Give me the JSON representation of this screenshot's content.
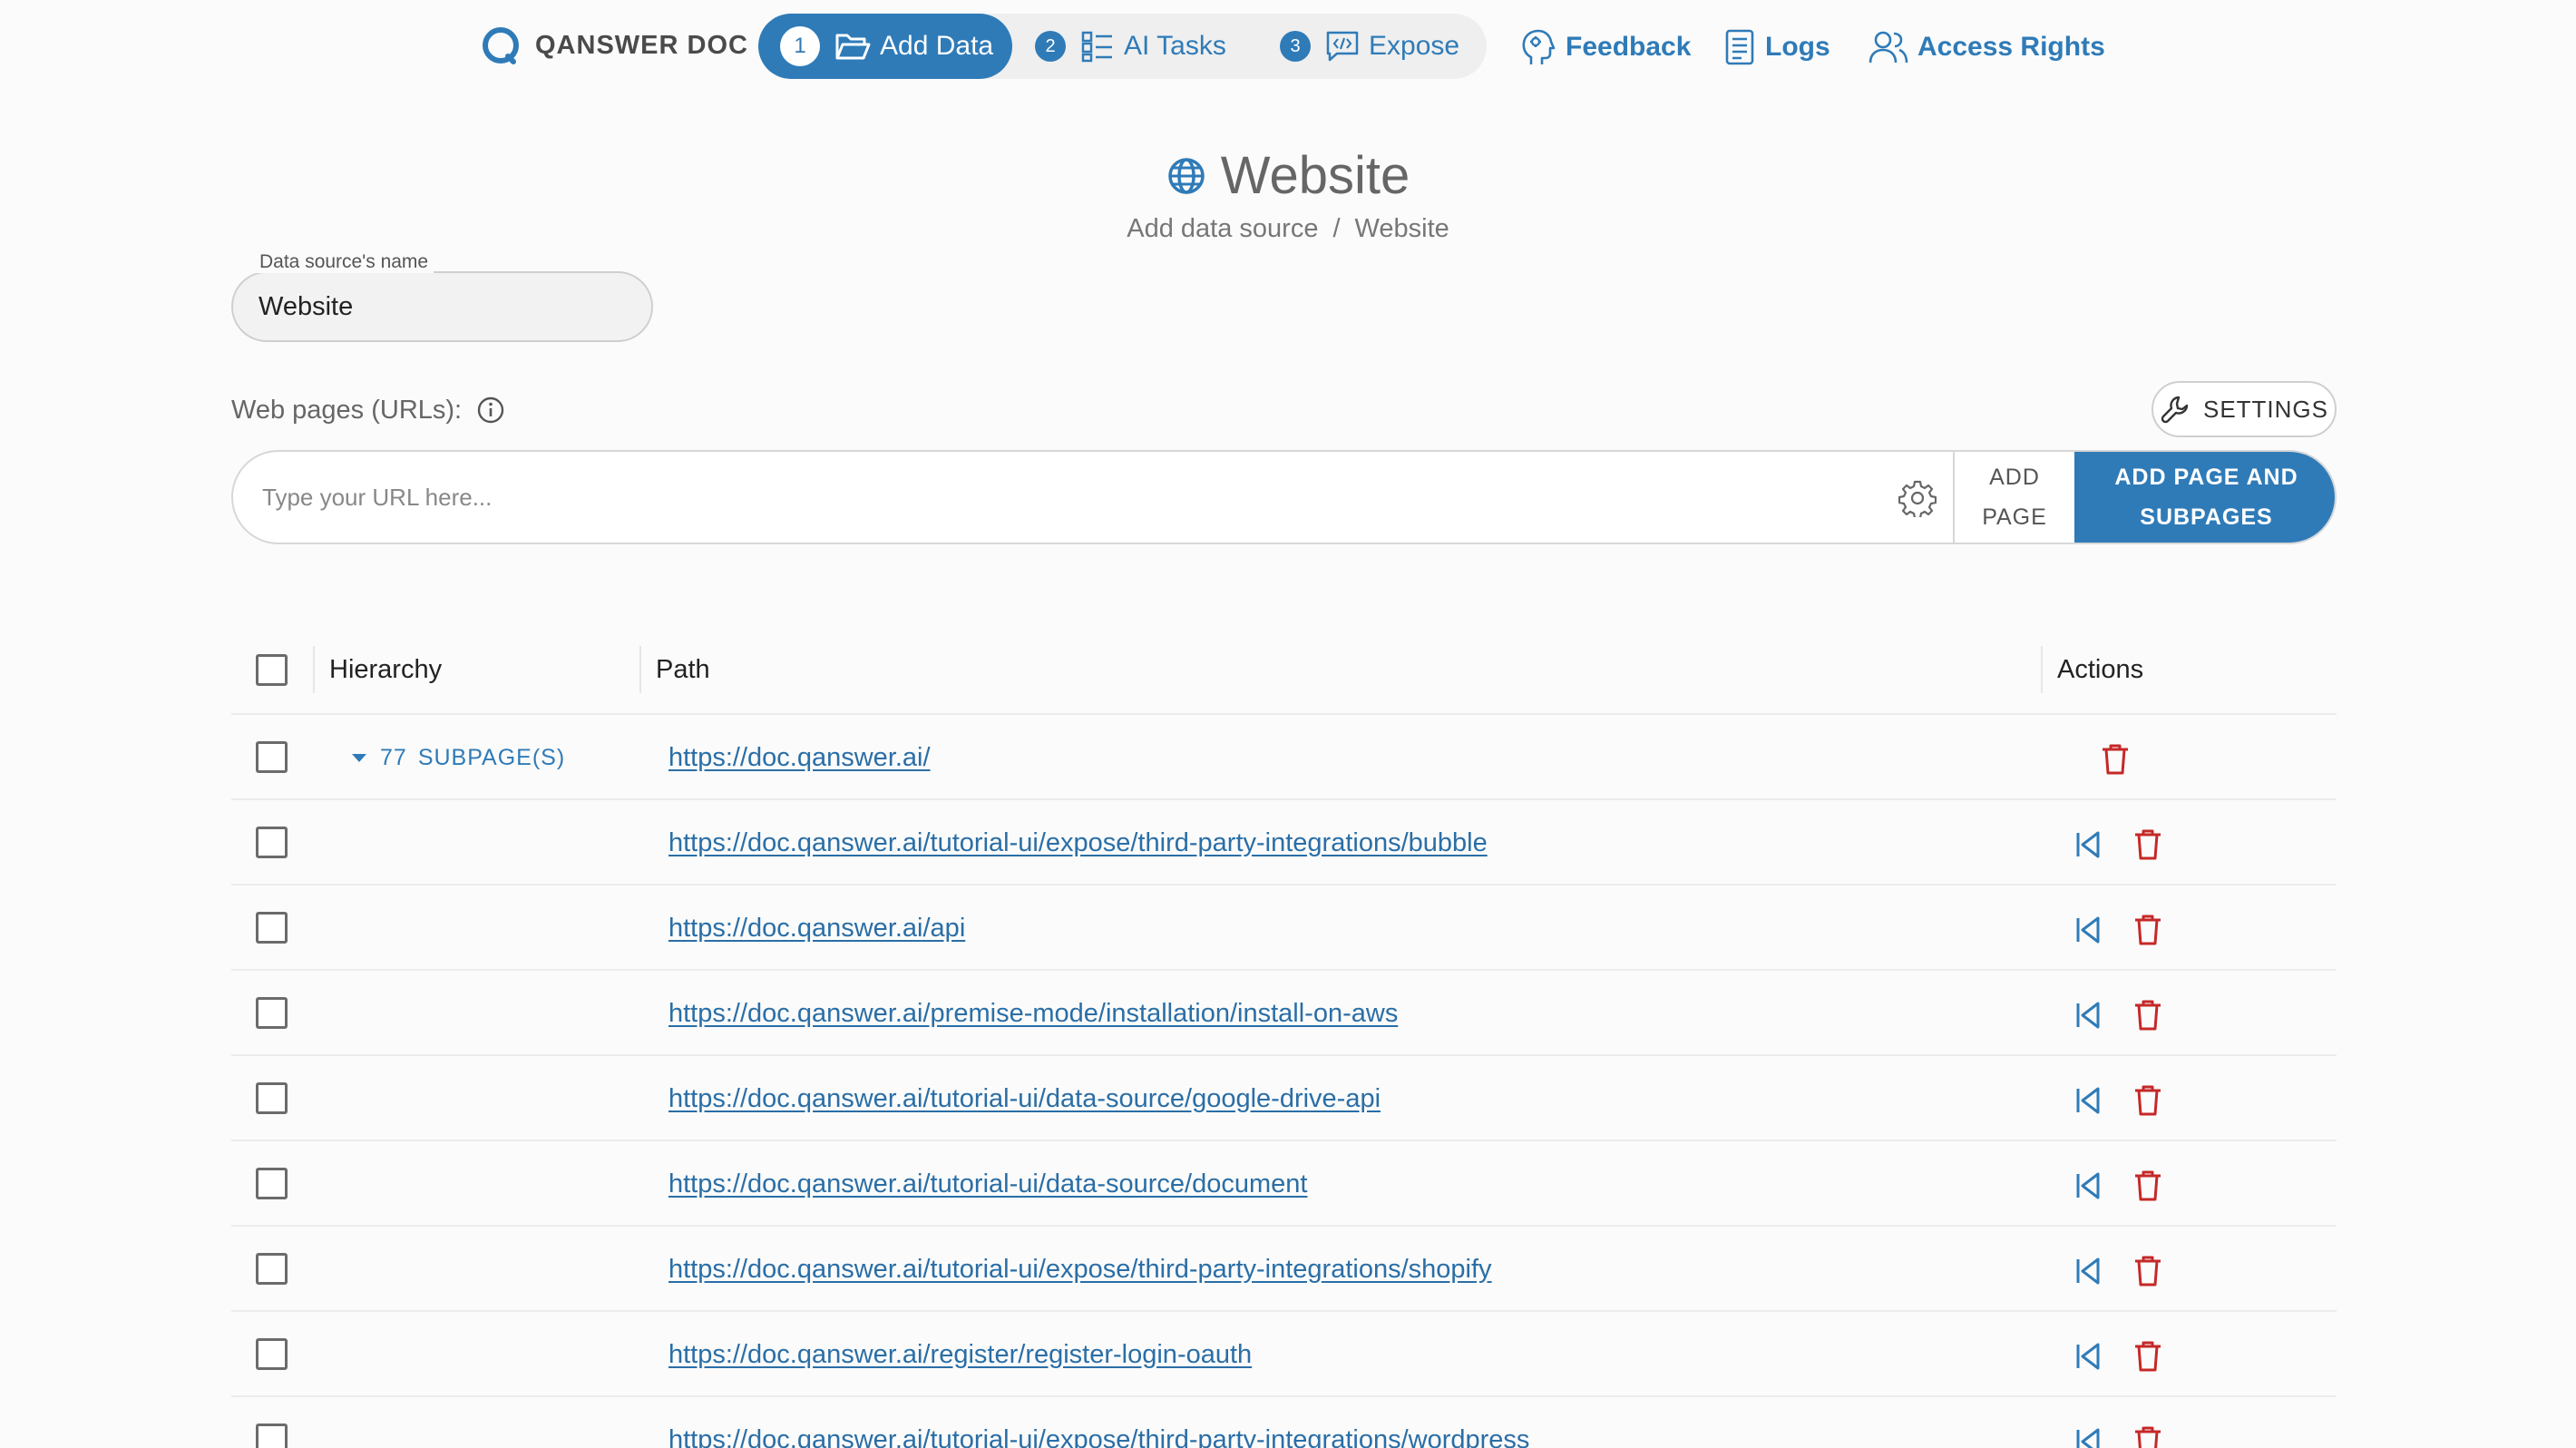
{
  "brand": {
    "name": "QANSWER DOC"
  },
  "steps": [
    {
      "num": "1",
      "label": "Add Data"
    },
    {
      "num": "2",
      "label": "AI Tasks"
    },
    {
      "num": "3",
      "label": "Expose"
    }
  ],
  "nav": {
    "feedback": "Feedback",
    "logs": "Logs",
    "access": "Access Rights"
  },
  "header": {
    "title": "Website",
    "breadcrumb": [
      "Add data source",
      "/",
      "Website"
    ]
  },
  "form": {
    "name_label": "Data source's name",
    "name_value": "Website",
    "urls_label": "Web pages (URLs):",
    "settings": "SETTINGS",
    "url_placeholder": "Type your URL here...",
    "add_page": [
      "ADD",
      "PAGE"
    ],
    "add_subpages": "ADD PAGE AND SUBPAGES"
  },
  "table": {
    "headers": {
      "hierarchy": "Hierarchy",
      "path": "Path",
      "actions": "Actions"
    },
    "root": {
      "count": "77",
      "label": "SUBPAGE(S)",
      "path": "https://doc.qanswer.ai/"
    },
    "rows": [
      "https://doc.qanswer.ai/tutorial-ui/expose/third-party-integrations/bubble",
      "https://doc.qanswer.ai/api",
      "https://doc.qanswer.ai/premise-mode/installation/install-on-aws",
      "https://doc.qanswer.ai/tutorial-ui/data-source/google-drive-api",
      "https://doc.qanswer.ai/tutorial-ui/data-source/document",
      "https://doc.qanswer.ai/tutorial-ui/expose/third-party-integrations/shopify",
      "https://doc.qanswer.ai/register/register-login-oauth",
      "https://doc.qanswer.ai/tutorial-ui/expose/third-party-integrations/wordpress"
    ]
  },
  "colors": {
    "accent": "#2f7bb8",
    "delete": "#c62828",
    "link": "#2a6ea6"
  }
}
